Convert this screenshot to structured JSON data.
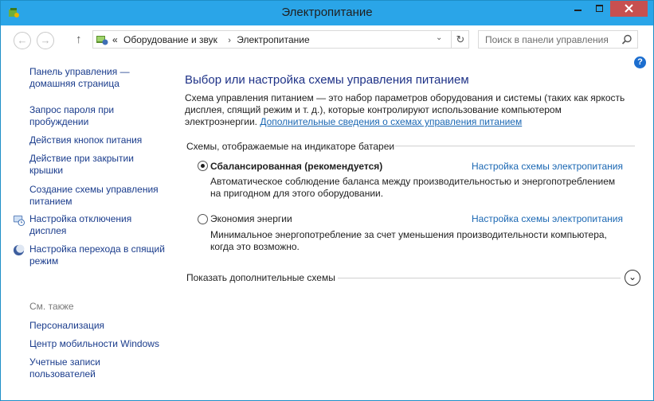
{
  "window": {
    "title": "Электропитание",
    "accent_color": "#2aa5e8"
  },
  "address": {
    "crumbs_prefix": "«",
    "crumb_1": "Оборудование и звук",
    "crumb_sep": "›",
    "crumb_2": "Электропитание"
  },
  "search": {
    "placeholder": "Поиск в панели управления"
  },
  "nav": {
    "home": "Панель управления — домашняя страница",
    "wake_password": "Запрос пароля при пробуждении",
    "power_buttons": "Действия кнопок питания",
    "lid_close": "Действие при закрытии крышки",
    "create_plan": "Создание схемы управления питанием",
    "display_off": "Настройка отключения дисплея",
    "sleep": "Настройка перехода в спящий режим",
    "see_also": "См. также",
    "personalization": "Персонализация",
    "mobility_center": "Центр мобильности Windows",
    "user_accounts": "Учетные записи пользователей"
  },
  "main": {
    "heading": "Выбор или настройка схемы управления питанием",
    "intro": "Схема управления питанием — это набор параметров оборудования и системы (таких как яркость дисплея, спящий режим и т. д.), которые контролируют использование компьютером электроэнергии.",
    "intro_link": "Дополнительные сведения о схемах управления питанием",
    "group_header": "Схемы, отображаемые на индикаторе батареи",
    "plans": [
      {
        "name": "Сбалансированная (рекомендуется)",
        "selected": true,
        "link": "Настройка схемы электропитания",
        "description": "Автоматическое соблюдение баланса между производительностью и энергопотреблением на пригодном для этого оборудовании."
      },
      {
        "name": "Экономия энергии",
        "selected": false,
        "link": "Настройка схемы электропитания",
        "description": "Минимальное энергопотребление за счет уменьшения производительности компьютера, когда это возможно."
      }
    ],
    "show_more": "Показать дополнительные схемы"
  },
  "help_label": "?"
}
